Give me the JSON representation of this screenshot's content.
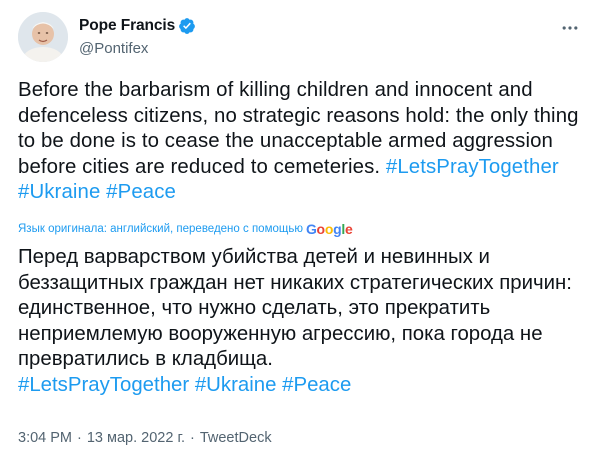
{
  "author": {
    "display_name": "Pope Francis",
    "handle": "@Pontifex",
    "verified": true
  },
  "tweet": {
    "text_parts": [
      "Before the barbarism of killing children and innocent and defenceless citizens, no strategic reasons hold: the only thing to be done is to cease the unacceptable armed aggression before cities are reduced to cemeteries. ",
      "#LetsPrayTogether",
      " ",
      "#Ukraine",
      " ",
      "#Peace"
    ]
  },
  "translation_note": {
    "label": "Язык оригинала: английский, переведено с помощью",
    "provider_letters": [
      "G",
      "o",
      "o",
      "g",
      "l",
      "e"
    ]
  },
  "translation": {
    "text": "Перед варварством убийства детей и невинных и беззащитных граждан нет никаких стратегических причин: единственное, что нужно сделать, это прекратить неприемлемую вооруженную агрессию, пока города не превратились в кладбища.",
    "hashtags": [
      "#LetsPrayTogether",
      "#Ukraine",
      "#Peace"
    ]
  },
  "meta": {
    "time": "3:04 PM",
    "date": "13 мар. 2022 г.",
    "source": "TweetDeck",
    "separator": "·"
  },
  "icons": {
    "verified": "verified-badge-icon",
    "more": "more-options-icon"
  },
  "colors": {
    "link": "#1d9bf0",
    "text": "#0f1419",
    "secondary": "#536471"
  }
}
